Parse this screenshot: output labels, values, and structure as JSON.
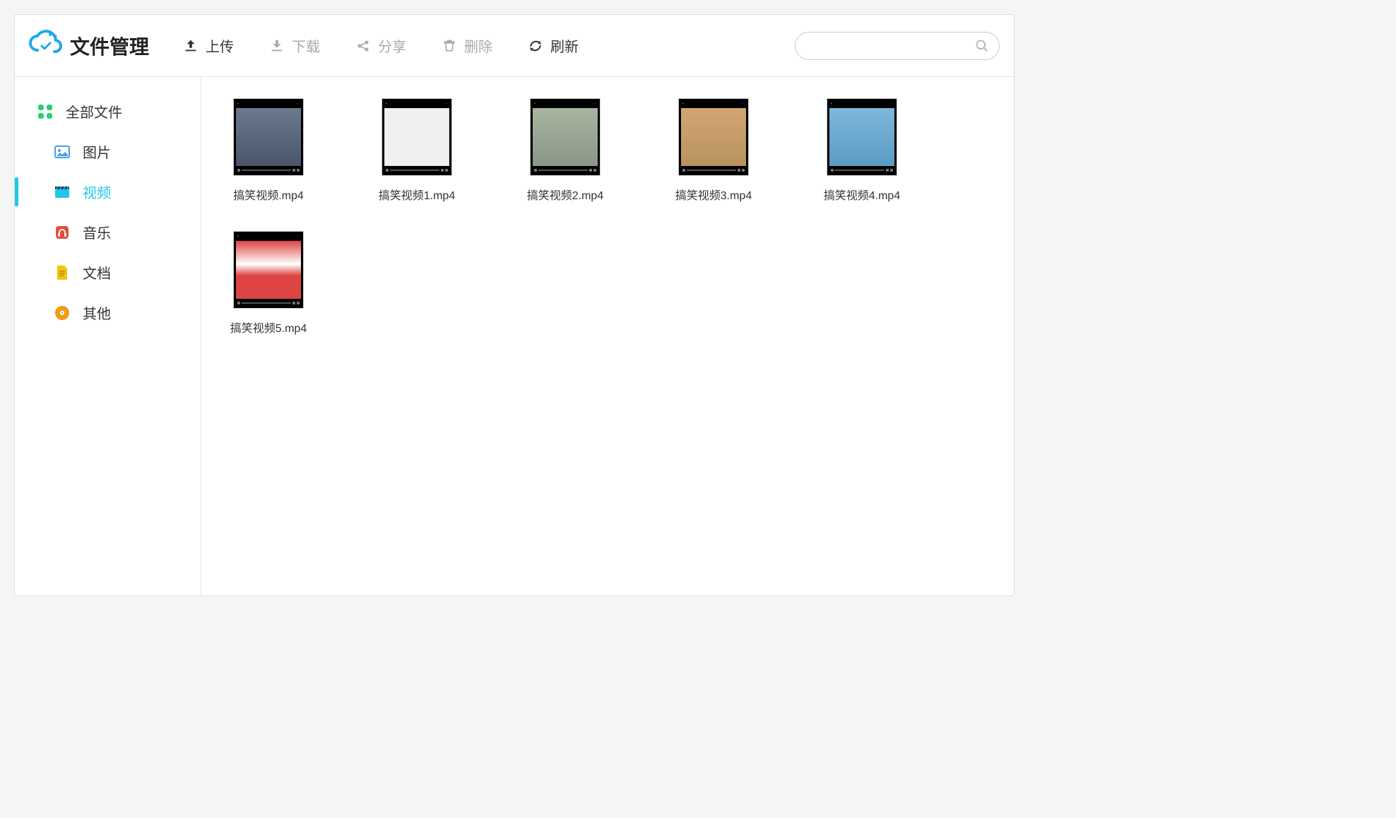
{
  "app_title": "文件管理",
  "toolbar": {
    "upload": "上传",
    "download": "下载",
    "share": "分享",
    "delete": "删除",
    "refresh": "刷新"
  },
  "search": {
    "placeholder": ""
  },
  "sidebar": {
    "all_files": "全部文件",
    "images": "图片",
    "videos": "视频",
    "music": "音乐",
    "documents": "文档",
    "others": "其他"
  },
  "files": [
    {
      "name": "搞笑视频.mp4",
      "thumb_class": "t1"
    },
    {
      "name": "搞笑视频1.mp4",
      "thumb_class": "t2"
    },
    {
      "name": "搞笑视频2.mp4",
      "thumb_class": "t3"
    },
    {
      "name": "搞笑视频3.mp4",
      "thumb_class": "t4"
    },
    {
      "name": "搞笑视频4.mp4",
      "thumb_class": "t5"
    },
    {
      "name": "搞笑视频5.mp4",
      "thumb_class": "t6"
    }
  ]
}
